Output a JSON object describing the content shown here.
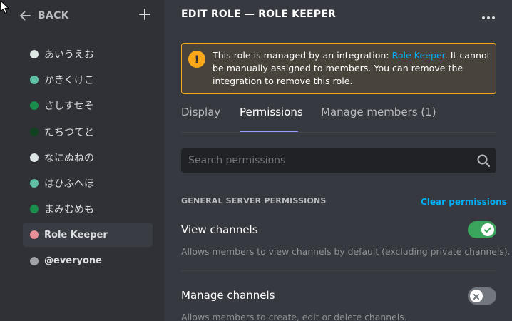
{
  "sidebar": {
    "back_label": "BACK",
    "roles": [
      {
        "label": "あいうえお",
        "color": "#dfe6e6"
      },
      {
        "label": "かきくけこ",
        "color": "#5fbfa7"
      },
      {
        "label": "さしすせそ",
        "color": "#1a8c4c"
      },
      {
        "label": "たちつてと",
        "color": "#10421f"
      },
      {
        "label": "なにぬねの",
        "color": "#dfe6e6"
      },
      {
        "label": "はひふへほ",
        "color": "#5fbfa7"
      },
      {
        "label": "まみむめも",
        "color": "#1a8c4c"
      },
      {
        "label": "Role Keeper",
        "color": "#e8909a"
      },
      {
        "label": "@everyone",
        "color": "#9fa1a6"
      }
    ]
  },
  "header": {
    "title": "EDIT ROLE — ROLE KEEPER"
  },
  "notice": {
    "text_before": "This role is managed by an integration: ",
    "link": "Role Keeper",
    "text_after": ". It cannot be manually assigned to members. You can remove the integration to remove this role.",
    "color": "#faa81a"
  },
  "tabs": [
    {
      "label": "Display"
    },
    {
      "label": "Permissions"
    },
    {
      "label": "Manage members (1)"
    }
  ],
  "search": {
    "placeholder": "Search permissions"
  },
  "section": {
    "heading": "GENERAL SERVER PERMISSIONS",
    "clear_label": "Clear permissions"
  },
  "permissions": [
    {
      "name": "View channels",
      "description": "Allows members to view channels by default (excluding private channels).",
      "enabled": true
    },
    {
      "name": "Manage channels",
      "description": "Allows members to create, edit or delete channels.",
      "enabled": false
    }
  ],
  "colors": {
    "accent": "#00aff4",
    "toggle_on": "#3ba55d",
    "tab_underline": "#949cf7"
  }
}
